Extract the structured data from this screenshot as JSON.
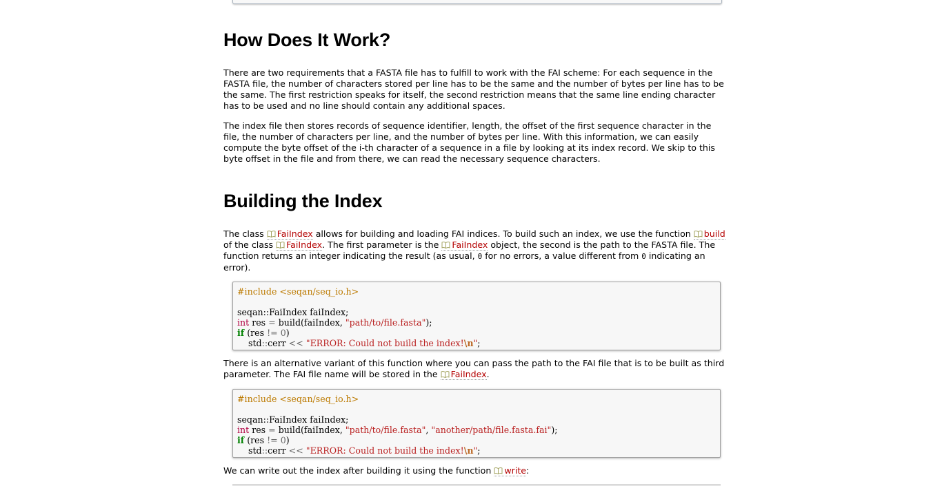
{
  "sections": {
    "how": {
      "heading": "How Does It Work?",
      "p1": "There are two requirements that a FASTA file has to fulfill to work with the FAI scheme: For each sequence in the FASTA file, the number of characters stored per line has to be the same and the number of bytes per line has to be the same. The first restriction speaks for itself, the second restriction means that the same line ending character has to be used and no line should contain any additional spaces.",
      "p2": "The index file then stores records of sequence identifier, length, the offset of the first sequence character in the file, the number of characters per line, and the number of bytes per line. With this information, we can easily compute the byte offset of the i-th character of a sequence in a file by looking at its index record. We skip to this byte offset in the file and from there, we can read the necessary sequence characters."
    },
    "building": {
      "heading": "Building the Index",
      "intro": {
        "t1": "The class ",
        "link1": "FaiIndex",
        "t2": " allows for building and loading FAI indices. To build such an index, we use the function ",
        "link2": "build",
        "t3": " of the class ",
        "link3": "FaiIndex",
        "t4": ". The first parameter is the ",
        "link4": "FaiIndex",
        "t5": " object, the second is the path to the FASTA file. The function returns an integer indicating the result (as usual, ",
        "code1": "0",
        "t6": " for no errors, a value different from ",
        "code2": "0",
        "t7": " indicating an error)."
      },
      "code1": {
        "include": "#include <seqan/seq_io.h>",
        "decl_ns": "seqan::",
        "decl_rest": "FaiIndex faiIndex;",
        "int_kw": "int",
        "res_assign": " res ",
        "eq": "=",
        "build_call": " build(faiIndex, ",
        "str1": "\"path/to/file.fasta\"",
        "close": ");",
        "if_kw": "if",
        "cond_open": " (res ",
        "neq": "!=",
        "zero": " 0",
        "cond_close": ")",
        "indent": "    ",
        "std": "std",
        "colons": "::",
        "cerr": "cerr ",
        "shl": "<<",
        "err_str_a": " \"ERROR: Could not build the index!",
        "err_esc": "\\n",
        "err_str_b": "\"",
        "semi": ";"
      },
      "alt": {
        "t1": "There is an alternative variant of this function where you can pass the path to the FAI file that is to be built as third parameter. The FAI file name will be stored in the ",
        "link": "FaiIndex",
        "t2": "."
      },
      "code2": {
        "include": "#include <seqan/seq_io.h>",
        "decl_ns": "seqan::",
        "decl_rest": "FaiIndex faiIndex;",
        "int_kw": "int",
        "res_assign": " res ",
        "eq": "=",
        "build_call": " build(faiIndex, ",
        "str1": "\"path/to/file.fasta\"",
        "comma": ", ",
        "str2": "\"another/path/file.fasta.fai\"",
        "close": ");",
        "if_kw": "if",
        "cond_open": " (res ",
        "neq": "!=",
        "zero": " 0",
        "cond_close": ")",
        "indent": "    ",
        "std": "std",
        "colons": "::",
        "cerr": "cerr ",
        "shl": "<<",
        "err_str_a": " \"ERROR: Could not build the index!",
        "err_esc": "\\n",
        "err_str_b": "\"",
        "semi": ";"
      },
      "write": {
        "t1": "We can write out the index after building it using the function ",
        "link": "write",
        "t2": ":"
      }
    }
  },
  "icons": {
    "api_link": "book-icon"
  },
  "colors": {
    "link": "#b40000",
    "code_bg": "#f7f7f7"
  }
}
